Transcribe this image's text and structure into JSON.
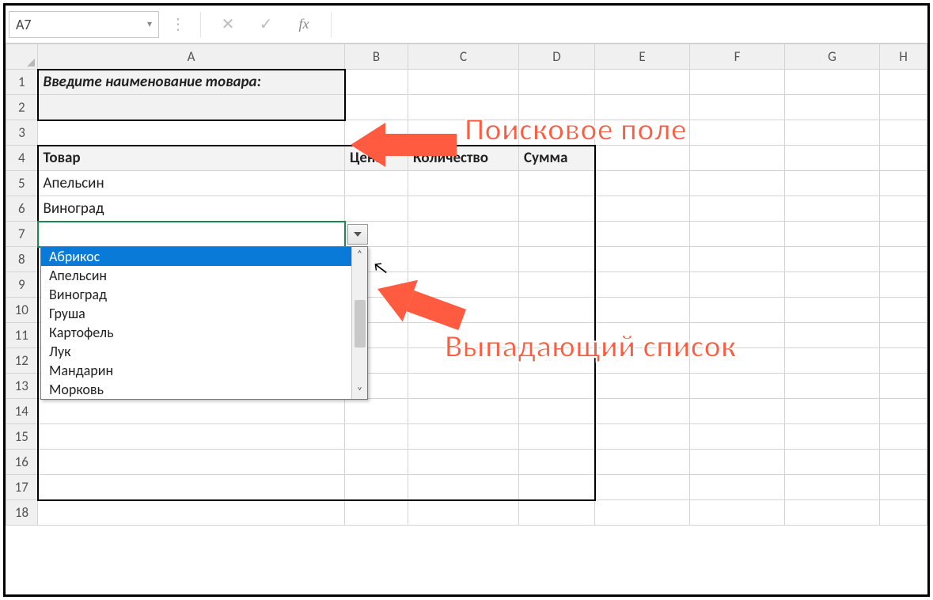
{
  "formula_bar": {
    "name_box": "A7",
    "fx_label": "fx"
  },
  "columns": [
    "A",
    "B",
    "C",
    "D",
    "E",
    "F",
    "G",
    "H"
  ],
  "rows": [
    "1",
    "2",
    "3",
    "4",
    "5",
    "6",
    "7",
    "8",
    "9",
    "10",
    "11",
    "12",
    "13",
    "14",
    "15",
    "16",
    "17",
    "18"
  ],
  "cells": {
    "A1": "Введите наименование товара:",
    "A4": "Товар",
    "B4": "Цена",
    "C4": "Количество",
    "D4": "Сумма",
    "A5": "Апельсин",
    "A6": "Виноград"
  },
  "dropdown": {
    "items": [
      "Абрикос",
      "Апельсин",
      "Виноград",
      "Груша",
      "Картофель",
      "Лук",
      "Мандарин",
      "Морковь"
    ],
    "selected_index": 0
  },
  "callouts": {
    "search_field": "Поисковое поле",
    "dropdown_list": "Выпадающий список"
  }
}
